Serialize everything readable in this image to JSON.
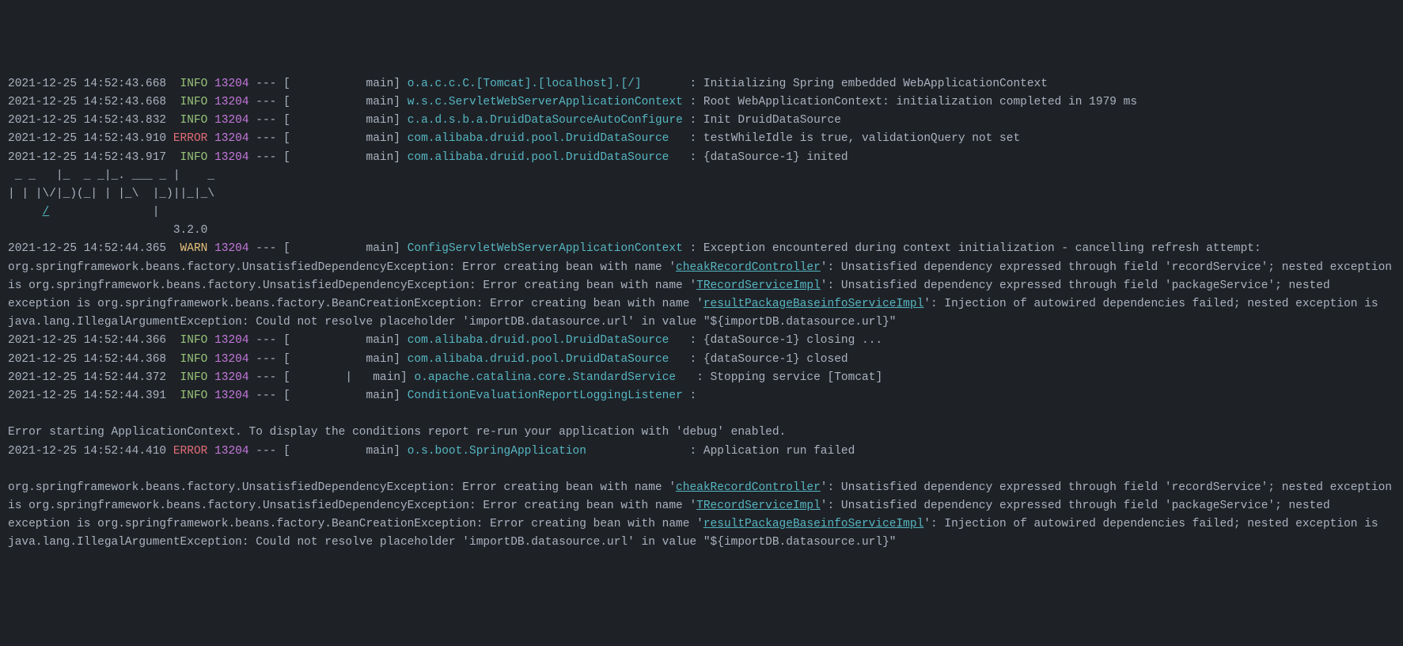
{
  "lines": [
    {
      "type": "log",
      "ts": "2021-12-25 14:52:43.668",
      "level": "INFO",
      "pid": "13204",
      "sep": " --- [           main] ",
      "logger": "o.a.c.c.C.[Tomcat].[localhost].[/]      ",
      "msg": " : Initializing Spring embedded WebApplicationContext"
    },
    {
      "type": "log",
      "ts": "2021-12-25 14:52:43.668",
      "level": "INFO",
      "pid": "13204",
      "sep": " --- [           main] ",
      "logger": "w.s.c.ServletWebServerApplicationContext",
      "msg": " : Root WebApplicationContext: initialization completed in 1979 ms"
    },
    {
      "type": "log",
      "ts": "2021-12-25 14:52:43.832",
      "level": "INFO",
      "pid": "13204",
      "sep": " --- [           main] ",
      "logger": "c.a.d.s.b.a.DruidDataSourceAutoConfigure",
      "msg": " : Init DruidDataSource"
    },
    {
      "type": "log",
      "ts": "2021-12-25 14:52:43.910",
      "level": "ERROR",
      "pid": "13204",
      "sep": " --- [           main] ",
      "logger": "com.alibaba.druid.pool.DruidDataSource  ",
      "msg": " : testWhileIdle is true, validationQuery not set"
    },
    {
      "type": "log",
      "ts": "2021-12-25 14:52:43.917",
      "level": "INFO",
      "pid": "13204",
      "sep": " --- [           main] ",
      "logger": "com.alibaba.druid.pool.DruidDataSource  ",
      "msg": " : {dataSource-1} inited"
    },
    {
      "type": "banner",
      "text": " _ _   |_  _ _|_. ___ _ |    _ "
    },
    {
      "type": "banner",
      "text": "| | |\\/|_)(_| | |_\\  |_)||_|_\\ "
    },
    {
      "type": "banner-link",
      "prefix": "     ",
      "link": "/",
      "suffix": "               |         "
    },
    {
      "type": "banner",
      "text": "                        3.2.0 "
    },
    {
      "type": "log-warn",
      "ts": "2021-12-25 14:52:44.365",
      "level": "WARN",
      "pid": "13204",
      "sep": " --- [           main] ",
      "logger": "ConfigServletWebServerApplicationContext",
      "parts": [
        {
          "t": "text",
          "v": " : Exception encountered during context initialization - cancelling refresh attempt: org.springframework.beans.factory.UnsatisfiedDependencyException: Error creating bean with name '"
        },
        {
          "t": "link",
          "v": "cheakRecordController"
        },
        {
          "t": "text",
          "v": "': Unsatisfied dependency expressed through field 'recordService'; nested exception is org.springframework.beans.factory.UnsatisfiedDependencyException: Error creating bean with name '"
        },
        {
          "t": "link",
          "v": "TRecordServiceImpl"
        },
        {
          "t": "text",
          "v": "': Unsatisfied dependency expressed through field 'packageService'; nested exception is org.springframework.beans.factory.BeanCreationException: Error creating bean with name '"
        },
        {
          "t": "link",
          "v": "resultPackageBaseinfoServiceImpl"
        },
        {
          "t": "text",
          "v": "': Injection of autowired dependencies failed; nested exception is java.lang.IllegalArgumentException: Could not resolve placeholder 'importDB.datasource.url' in value \"${importDB.datasource.url}\""
        }
      ]
    },
    {
      "type": "log",
      "ts": "2021-12-25 14:52:44.366",
      "level": "INFO",
      "pid": "13204",
      "sep": " --- [           main] ",
      "logger": "com.alibaba.druid.pool.DruidDataSource  ",
      "msg": " : {dataSource-1} closing ..."
    },
    {
      "type": "log",
      "ts": "2021-12-25 14:52:44.368",
      "level": "INFO",
      "pid": "13204",
      "sep": " --- [           main] ",
      "logger": "com.alibaba.druid.pool.DruidDataSource  ",
      "msg": " : {dataSource-1} closed"
    },
    {
      "type": "log-cursor",
      "ts": "2021-12-25 14:52:44.372",
      "level": "INFO",
      "pid": "13204",
      "sep": " --- [        ",
      "cursor": "|",
      "sep2": "   main] ",
      "logger": "o.apache.catalina.core.StandardService  ",
      "msg": " : Stopping service [Tomcat]"
    },
    {
      "type": "log",
      "ts": "2021-12-25 14:52:44.391",
      "level": "INFO",
      "pid": "13204",
      "sep": " --- [           main] ",
      "logger": "ConditionEvaluationReportLoggingListener",
      "msg": " : "
    },
    {
      "type": "blank",
      "text": ""
    },
    {
      "type": "plain",
      "text": "Error starting ApplicationContext. To display the conditions report re-run your application with 'debug' enabled."
    },
    {
      "type": "log",
      "ts": "2021-12-25 14:52:44.410",
      "level": "ERROR",
      "pid": "13204",
      "sep": " --- [           main] ",
      "logger": "o.s.boot.SpringApplication              ",
      "msg": " : Application run failed"
    },
    {
      "type": "blank",
      "text": ""
    },
    {
      "type": "exception",
      "parts": [
        {
          "t": "text",
          "v": "org.springframework.beans.factory.UnsatisfiedDependencyException: Error creating bean with name '"
        },
        {
          "t": "link",
          "v": "cheakRecordController"
        },
        {
          "t": "text",
          "v": "': Unsatisfied dependency expressed through field 'recordService'; nested exception is org.springframework.beans.factory.UnsatisfiedDependencyException: Error creating bean with name '"
        },
        {
          "t": "link",
          "v": "TRecordServiceImpl"
        },
        {
          "t": "text",
          "v": "': Unsatisfied dependency expressed through field 'packageService'; nested exception is org.springframework.beans.factory.BeanCreationException: Error creating bean with name '"
        },
        {
          "t": "link",
          "v": "resultPackageBaseinfoServiceImpl"
        },
        {
          "t": "text",
          "v": "': Injection of autowired dependencies failed; nested exception is java.lang.IllegalArgumentException: Could not resolve placeholder 'importDB.datasource.url' in value \"${importDB.datasource.url}\""
        }
      ]
    }
  ],
  "levelPad": {
    "INFO": "  INFO ",
    "WARN": "  WARN ",
    "ERROR": " ERROR "
  }
}
